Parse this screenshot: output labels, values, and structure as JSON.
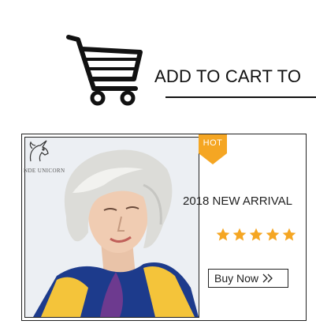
{
  "header": {
    "cart_icon": "shopping-cart-icon",
    "cta_text": "ADD TO CART TO"
  },
  "product": {
    "brand": "NDE UNICORN",
    "brand_icon": "unicorn-logo",
    "badge": "HOT",
    "headline": "2018 NEW ARRIVAL",
    "rating": 5,
    "rating_max": 5,
    "buy_label": "Buy Now",
    "buy_icon": "double-chevron-right-icon"
  },
  "colors": {
    "badge": "#f5a623",
    "stars": "#f5a623",
    "text": "#222222",
    "border": "#222222"
  }
}
